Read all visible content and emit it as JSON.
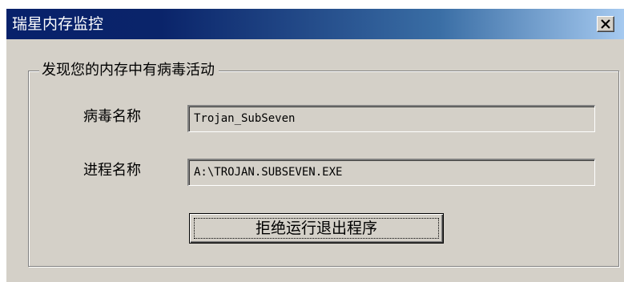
{
  "window": {
    "title": "瑞星内存监控",
    "close_icon": "close-icon"
  },
  "group": {
    "legend": "发现您的内存中有病毒活动"
  },
  "virus_name": {
    "label": "病毒名称",
    "value": "Trojan_SubSeven"
  },
  "process_name": {
    "label": "进程名称",
    "value": "A:\\TROJAN.SUBSEVEN.EXE"
  },
  "action_button": {
    "label": "拒绝运行退出程序"
  },
  "colors": {
    "title_bar_start": "#0a246a",
    "title_bar_end": "#a6caf0",
    "dialog_face": "#d4d0c8"
  }
}
